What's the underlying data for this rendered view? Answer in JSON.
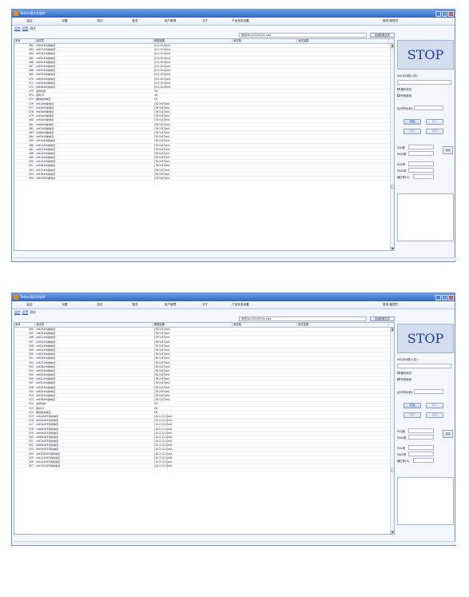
{
  "app_title": "Tester测试台软件",
  "menu": [
    "监控",
    "设置",
    "测试",
    "登录",
    "用户管理",
    "关于",
    "产品信息设置"
  ],
  "login_status": "登录:管理员",
  "tabs": [
    "监控",
    "设置",
    "测试"
  ],
  "columns": [
    "序号",
    "测试项",
    "数据结果",
    "测试值",
    "测试结果"
  ],
  "load_config_button": "加载配置文件",
  "stop_label": "STOP",
  "sn_label": "SN(手动录入扫)",
  "checkbox_loop": "通讯测试",
  "checkbox_fail_continue": "失败继续",
  "runtime_label": "运行时间(秒)",
  "start_button": "开始",
  "stop_button": "停止",
  "pause_button": "暂停",
  "resume_button": "继续",
  "fail_count_label": "FAIL数",
  "pass_count_label": "PASS数",
  "fail_rate_label": "FAIL率",
  "pass_rate_label": "PASS率",
  "yield_label": "通过率(%)",
  "clear_button": "清除",
  "panels": [
    {
      "filename": "测试36-20220914.xlsx",
      "rows": [
        {
          "n": "",
          "i": "462",
          "item": "cell24#均衡电流",
          "result": "[0.0;10.0]mA"
        },
        {
          "n": "",
          "i": "463",
          "item": "cell27#均衡电流",
          "result": "[0.0;10.0]mA"
        },
        {
          "n": "",
          "i": "464",
          "item": "cell28#均衡电流",
          "result": "[0.0;10.0]mA"
        },
        {
          "n": "",
          "i": "465",
          "item": "cell29#均衡电流",
          "result": "[0.0;10.0]mA"
        },
        {
          "n": "",
          "i": "466",
          "item": "cell30#均衡电流",
          "result": "[0.0;10.0]mA"
        },
        {
          "n": "",
          "i": "467",
          "item": "cell31#均衡电流",
          "result": "[0.0;10.0]mA"
        },
        {
          "n": "",
          "i": "468",
          "item": "cell32#均衡电流",
          "result": "[0.0;10.0]mA"
        },
        {
          "n": "",
          "i": "469",
          "item": "cell33#均衡电流",
          "result": "[0.0;10.0]mA"
        },
        {
          "n": "",
          "i": "470",
          "item": "cell34#均衡电流",
          "result": "[0.0;10.0]mA"
        },
        {
          "n": "",
          "i": "471",
          "item": "cell35#均衡电流",
          "result": "[0.0;10.0]mA"
        },
        {
          "n": "",
          "i": "472",
          "item": "cell36#均衡电流",
          "result": "[0.0;10.0]mA"
        },
        {
          "n": "",
          "i": "473",
          "item": "关闭均衡",
          "result": "OK"
        },
        {
          "n": "",
          "i": "474",
          "item": "延时1S",
          "result": "OK"
        },
        {
          "n": "",
          "i": "475",
          "item": "模拟电池电压",
          "result": "OK"
        },
        {
          "n": "",
          "i": "476",
          "item": "cell1#均衡电流",
          "result": "[78.5;87]mA"
        },
        {
          "n": "",
          "i": "477",
          "item": "cell2#均衡电流",
          "result": "[78.5;87]mA"
        },
        {
          "n": "",
          "i": "478",
          "item": "cell3#均衡电流",
          "result": "[78.5;87]mA"
        },
        {
          "n": "",
          "i": "479",
          "item": "cell4#均衡电流",
          "result": "[78.5;87]mA"
        },
        {
          "n": "",
          "i": "480",
          "item": "cell5#均衡电流",
          "result": "[78.5;87]mA"
        },
        {
          "n": "",
          "i": "481",
          "item": "cell6#均衡电流",
          "result": "[78.5;87]mA"
        },
        {
          "n": "",
          "i": "482",
          "item": "cell7#均衡电流",
          "result": "[78.5;87]mA"
        },
        {
          "n": "",
          "i": "483",
          "item": "cell8#均衡电流",
          "result": "[78.5;87]mA"
        },
        {
          "n": "",
          "i": "484",
          "item": "cell9#均衡电流",
          "result": "[78.5;87]mA"
        },
        {
          "n": "",
          "i": "485",
          "item": "cell10#均衡电流",
          "result": "[78.5;87]mA"
        },
        {
          "n": "",
          "i": "486",
          "item": "cell11#均衡电流",
          "result": "[78.5;87]mA"
        },
        {
          "n": "",
          "i": "487",
          "item": "cell12#均衡电流",
          "result": "[78.5;87]mA"
        },
        {
          "n": "",
          "i": "488",
          "item": "cell13#均衡电流",
          "result": "[78.5;87]mA"
        },
        {
          "n": "",
          "i": "489",
          "item": "cell14#均衡电流",
          "result": "[78.5;87]mA"
        },
        {
          "n": "",
          "i": "490",
          "item": "cell15#均衡电流",
          "result": "[78.5;87]mA"
        },
        {
          "n": "",
          "i": "491",
          "item": "cell16#均衡电流",
          "result": "[78.5;87]mA"
        },
        {
          "n": "",
          "i": "492",
          "item": "cell17#均衡电流",
          "result": "[78.5;87]mA"
        },
        {
          "n": "",
          "i": "493",
          "item": "cell18#均衡电流",
          "result": "[78.5;87]mA"
        },
        {
          "n": "",
          "i": "494",
          "item": "cell19#均衡电流",
          "result": "[78.5;87]mA"
        }
      ]
    },
    {
      "filename": "测试36-20220914.xlsx",
      "rows": [
        {
          "n": "",
          "i": "494",
          "item": "cell19#均衡电流",
          "result": "[78.5;87]mA"
        },
        {
          "n": "",
          "i": "495",
          "item": "cell20#均衡电流",
          "result": "[78.5;87]mA"
        },
        {
          "n": "",
          "i": "496",
          "item": "cell21#均衡电流",
          "result": "[78.5;87]mA"
        },
        {
          "n": "",
          "i": "497",
          "item": "cell22#均衡电流",
          "result": "[78.5;87]mA"
        },
        {
          "n": "",
          "i": "498",
          "item": "cell23#均衡电流",
          "result": "[78.5;87]mA"
        },
        {
          "n": "",
          "i": "499",
          "item": "cell24#均衡电流",
          "result": "[78.5;87]mA"
        },
        {
          "n": "",
          "i": "500",
          "item": "cell25#均衡电流",
          "result": "[78.5;87]mA"
        },
        {
          "n": "",
          "i": "501",
          "item": "cell26#均衡电流",
          "result": "[78.5;87]mA"
        },
        {
          "n": "",
          "i": "502",
          "item": "cell27#均衡电流",
          "result": "[78.5;87]mA"
        },
        {
          "n": "",
          "i": "503",
          "item": "cell28#均衡电流",
          "result": "[78.5;87]mA"
        },
        {
          "n": "",
          "i": "504",
          "item": "cell29#均衡电流",
          "result": "[78.5;87]mA"
        },
        {
          "n": "",
          "i": "505",
          "item": "cell30#均衡电流",
          "result": "[78.5;87]mA"
        },
        {
          "n": "",
          "i": "506",
          "item": "cell31#均衡电流",
          "result": "[78.5;87]mA"
        },
        {
          "n": "",
          "i": "507",
          "item": "cell32#均衡电流",
          "result": "[78.5;87]mA"
        },
        {
          "n": "",
          "i": "508",
          "item": "cell33#均衡电流",
          "result": "[78.5;87]mA"
        },
        {
          "n": "",
          "i": "509",
          "item": "cell34#均衡电流",
          "result": "[78.5;87]mA"
        },
        {
          "n": "",
          "i": "510",
          "item": "cell35#均衡电流",
          "result": "[78.5;87]mA"
        },
        {
          "n": "",
          "i": "511",
          "item": "cell36#均衡电流",
          "result": "[78.5;87]mA"
        },
        {
          "n": "",
          "i": "512",
          "item": "关闭均衡",
          "result": "OK"
        },
        {
          "n": "",
          "i": "513",
          "item": "延时1S",
          "result": "OK"
        },
        {
          "n": "",
          "i": "514",
          "item": "模拟电池电压",
          "result": "OK"
        },
        {
          "n": "",
          "i": "515",
          "item": "cell1#AFE待机电流",
          "result": "[10.2;12.2]mA"
        },
        {
          "n": "",
          "i": "516",
          "item": "cell2#AFE待机电流",
          "result": "[10.2;12.2]mA"
        },
        {
          "n": "",
          "i": "517",
          "item": "cell3#AFE待机电流",
          "result": "[10.2;12.2]mA"
        },
        {
          "n": "",
          "i": "518",
          "item": "cell4#AFE待机电流",
          "result": "[10.2;12.2]mA"
        },
        {
          "n": "",
          "i": "519",
          "item": "cell5#AFE待机电流",
          "result": "[10.2;12.2]mA"
        },
        {
          "n": "",
          "i": "520",
          "item": "cell6#AFE待机电流",
          "result": "[10.2;12.2]mA"
        },
        {
          "n": "",
          "i": "521",
          "item": "cell7#AFE待机电流",
          "result": "[10.2;12.2]mA"
        },
        {
          "n": "",
          "i": "522",
          "item": "cell8#AFE待机电流",
          "result": "[10.2;12.2]mA"
        },
        {
          "n": "",
          "i": "523",
          "item": "cell9#AFE待机电流",
          "result": "[10.2;12.2]mA"
        },
        {
          "n": "",
          "i": "524",
          "item": "cell10#AFE待机电流",
          "result": "[10.2;12.2]mA"
        },
        {
          "n": "",
          "i": "525",
          "item": "cell11#AFE待机电流",
          "result": "[10.2;12.2]mA"
        },
        {
          "n": "",
          "i": "526",
          "item": "cell12#AFE待机电流",
          "result": "[10.2;12.2]mA"
        },
        {
          "n": "",
          "i": "527",
          "item": "cell13#AFE待机电流",
          "result": "[10.2;12.2]mA"
        }
      ]
    }
  ]
}
